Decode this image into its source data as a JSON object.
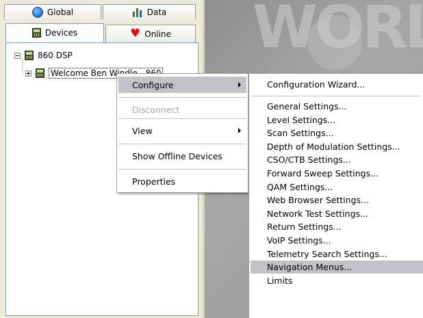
{
  "tabs": {
    "global": "Global",
    "data": "Data",
    "devices": "Devices",
    "online": "Online"
  },
  "tree": {
    "root": "860 DSP",
    "child": "Welcome Ben Windle - 860"
  },
  "context_menu": [
    {
      "label": "Configure",
      "submenu": true,
      "highlighted": true,
      "enabled": true
    },
    {
      "label": "Disconnect",
      "submenu": false,
      "highlighted": false,
      "enabled": false
    },
    {
      "label": "View",
      "submenu": true,
      "highlighted": false,
      "enabled": true
    },
    {
      "label": "Show Offline Devices",
      "submenu": false,
      "highlighted": false,
      "enabled": true
    },
    {
      "label": "Properties",
      "submenu": false,
      "highlighted": false,
      "enabled": true
    }
  ],
  "submenu": {
    "wizard": "Configuration Wizard...",
    "items": [
      "General Settings...",
      "Level Settings...",
      "Scan Settings...",
      "Depth of Modulation Settings...",
      "CSO/CTB Settings...",
      "Forward Sweep Settings...",
      "QAM Settings...",
      "Web Browser Settings...",
      "Network Test Settings...",
      "Return Settings...",
      "VoIP Settings...",
      "Telemetry Search Settings...",
      "Navigation Menus...",
      "Limits"
    ],
    "highlighted_item": "Navigation Menus..."
  },
  "background_watermark": "WORL",
  "colors": {
    "menu_highlight": "#c1c1c7",
    "disabled_text": "#a7a6aa",
    "globe_icon": "#2c7bd4",
    "data_icon": "#3d7a2a",
    "online_icon": "#d21818"
  }
}
